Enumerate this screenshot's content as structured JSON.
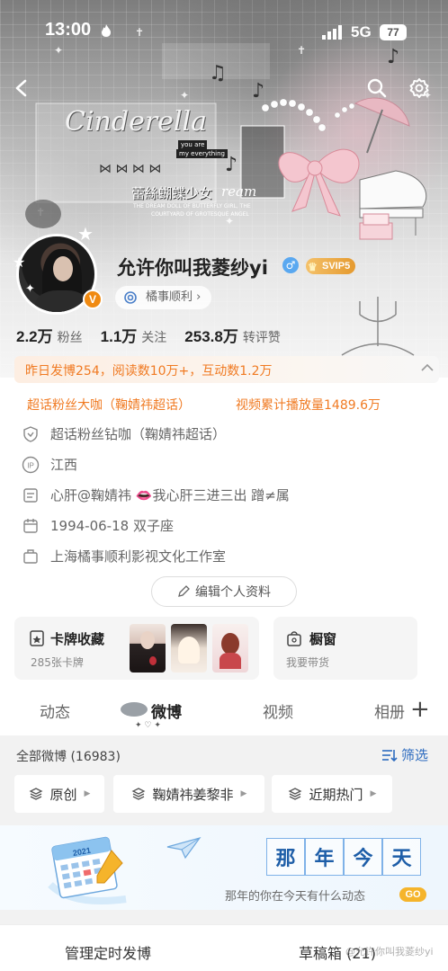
{
  "status_bar": {
    "time": "13:00",
    "network": "5G",
    "battery": "77"
  },
  "header": {
    "decor_text": {
      "logo": "Cinderella",
      "small1": "you are",
      "small2": "my everything",
      "chinese": "蕾絲蝴蝶少女",
      "dream": "ream",
      "en1": "THE DREAM DOLL OF BUTTERFLY GIRL, THE",
      "en2": "COURTYARD OF GROTESQUE ANGEL"
    }
  },
  "profile": {
    "username": "允许你叫我菱纱yi",
    "gender_symbol": "♂",
    "vip_badge": "SVIP5",
    "verified_badge": "V",
    "org_tag": "橘事顺利 ›"
  },
  "stats": [
    {
      "num": "2.2万",
      "label": "粉丝"
    },
    {
      "num": "1.1万",
      "label": "关注"
    },
    {
      "num": "253.8万",
      "label": "转评赞"
    }
  ],
  "highlight": "昨日发博254，阅读数10万+，互动数1.2万",
  "honors": {
    "left": "超话粉丝大咖（鞠婧祎超话）",
    "right": "视频累计播放量1489.6万"
  },
  "info": {
    "super_fan": "超话粉丝钻咖（鞠婧祎超话）",
    "ip_label": "IP",
    "location": "江西",
    "bio": "心肝@鞠婧祎 👄我心肝三进三出 蹭≠属",
    "birthday": "1994-06-18 双子座",
    "company": "上海橘事顺利影视文化工作室"
  },
  "edit_button": "编辑个人资料",
  "cards": {
    "collection_title": "卡牌收藏",
    "collection_sub": "285张卡牌",
    "shop_title": "橱窗",
    "shop_sub": "我要带货"
  },
  "tabs": [
    "动态",
    "微博",
    "视频",
    "相册"
  ],
  "tab_plus": "+",
  "feed": {
    "count": "全部微博 (16983)",
    "filter": "筛选",
    "chips": [
      "原创",
      "鞠婧祎姜黎非",
      "近期热门"
    ]
  },
  "memory": {
    "calendar_year": "2021",
    "title_chars": [
      "那",
      "年",
      "今",
      "天"
    ],
    "subtitle": "那年的你在今天有什么动态",
    "go": "GO"
  },
  "bottom": {
    "left": "管理定时发博",
    "right": "草稿箱 (21)"
  },
  "watermark": "@允许你叫我菱纱yi",
  "colors": {
    "orange": "#f07a22",
    "blue_link": "#2d6bbf",
    "svip_gold": "#e59a2f",
    "verified_orange": "#f08a12"
  }
}
